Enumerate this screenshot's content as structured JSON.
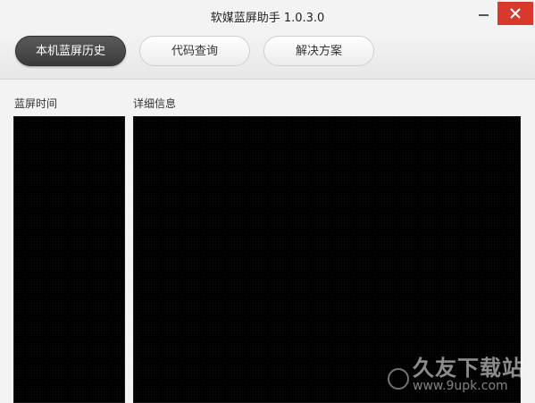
{
  "window": {
    "title": "软媒蓝屏助手 1.0.3.0"
  },
  "titlebar": {
    "minimize_icon": "minimize-icon",
    "close_icon": "close-icon",
    "close_color": "#d7392d"
  },
  "tabs": [
    {
      "label": "本机蓝屏历史",
      "active": true
    },
    {
      "label": "代码查询",
      "active": false
    },
    {
      "label": "解决方案",
      "active": false
    }
  ],
  "sections": {
    "time_label": "蓝屏时间",
    "detail_label": "详细信息"
  },
  "watermark": {
    "main": "久友下载站",
    "url": "www.9upk.com"
  }
}
